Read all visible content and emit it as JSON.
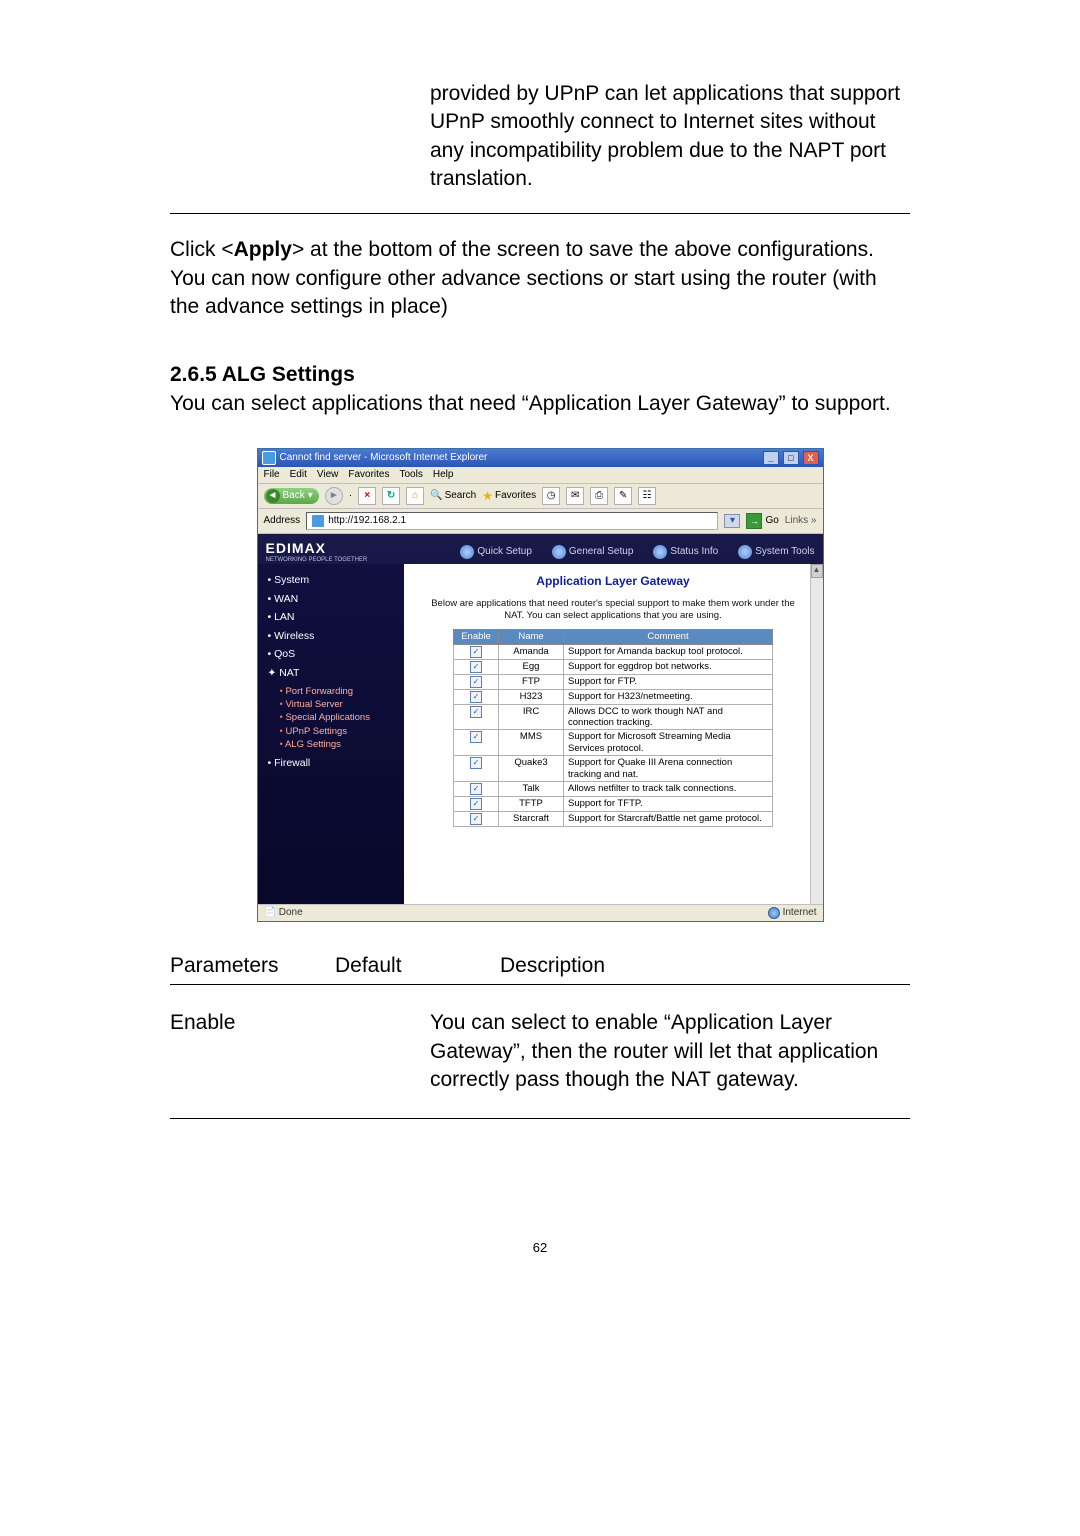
{
  "body": {
    "para_upnp": "provided by UPnP can let applications that support UPnP smoothly connect to Internet sites without any incompatibility problem due to the NAPT port translation.",
    "para_apply_pre": "Click <",
    "para_apply_bold": "Apply",
    "para_apply_post": "> at the bottom of the screen to save the above configurations. You can now configure other advance sections or start using the router (with the advance settings in place)",
    "section_no": "2.6.5 ALG Settings",
    "para_alg": "You can select applications that need “Application Layer Gateway” to support.",
    "params_header": {
      "c1": "Parameters",
      "c2": "Default",
      "c3": "Description"
    },
    "params_row": {
      "c1": "Enable",
      "c2": "",
      "c3": "You can select to enable “Application Layer Gateway”, then the router will let that application correctly pass though the NAT gateway."
    },
    "page_num": "62"
  },
  "shot": {
    "title": "Cannot find server - Microsoft Internet Explorer",
    "menu": [
      "File",
      "Edit",
      "View",
      "Favorites",
      "Tools",
      "Help"
    ],
    "toolbar": {
      "back": "Back",
      "search": "Search",
      "favorites": "Favorites"
    },
    "address_label": "Address",
    "address_value": "http://192.168.2.1",
    "go": "Go",
    "links": "Links",
    "logo": "EDIMAX",
    "logo_sub": "NETWORKING PEOPLE TOGETHER",
    "top_tabs": [
      "Quick Setup",
      "General Setup",
      "Status Info",
      "System Tools"
    ],
    "sidebar_top": [
      "System",
      "WAN",
      "LAN",
      "Wireless",
      "QoS"
    ],
    "sidebar_nat": "NAT",
    "sidebar_sub": [
      "Port Forwarding",
      "Virtual Server",
      "Special Applications",
      "UPnP Settings",
      "ALG Settings"
    ],
    "sidebar_firewall": "Firewall",
    "main_title": "Application Layer Gateway",
    "main_desc": "Below are applications that need router's special support to make them work under the NAT. You can select applications that you are using.",
    "table_head": [
      "Enable",
      "Name",
      "Comment"
    ],
    "rows": [
      {
        "n": "Amanda",
        "c": "Support for Amanda backup tool protocol."
      },
      {
        "n": "Egg",
        "c": "Support for eggdrop bot networks."
      },
      {
        "n": "FTP",
        "c": "Support for FTP."
      },
      {
        "n": "H323",
        "c": "Support for H323/netmeeting."
      },
      {
        "n": "IRC",
        "c": "Allows DCC to work though NAT and connection tracking."
      },
      {
        "n": "MMS",
        "c": "Support for Microsoft Streaming Media Services protocol."
      },
      {
        "n": "Quake3",
        "c": "Support for Quake III Arena connection tracking and nat."
      },
      {
        "n": "Talk",
        "c": "Allows netfilter to track talk connections."
      },
      {
        "n": "TFTP",
        "c": "Support for TFTP."
      },
      {
        "n": "Starcraft",
        "c": "Support for Starcraft/Battle net game protocol."
      }
    ],
    "status_done": "Done",
    "status_net": "Internet"
  }
}
